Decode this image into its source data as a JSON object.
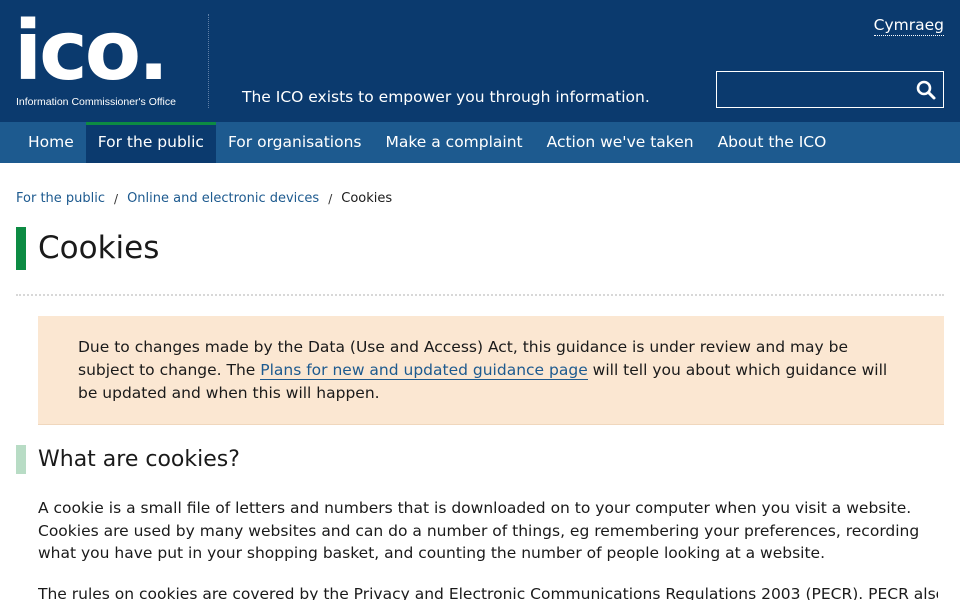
{
  "header": {
    "logo_text": "ico.",
    "logo_subtitle": "Information Commissioner's Office",
    "tagline": "The ICO exists to empower you through information.",
    "language_link": "Cymraeg",
    "search": {
      "value": "",
      "placeholder": ""
    },
    "colors": {
      "header_bg": "#0b3a6e",
      "nav_bg": "#1d5a8f",
      "active_accent": "#0d8b43"
    }
  },
  "nav": {
    "items": [
      {
        "label": "Home",
        "active": false
      },
      {
        "label": "For the public",
        "active": true
      },
      {
        "label": "For organisations",
        "active": false
      },
      {
        "label": "Make a complaint",
        "active": false
      },
      {
        "label": "Action we've taken",
        "active": false
      },
      {
        "label": "About the ICO",
        "active": false
      }
    ]
  },
  "breadcrumb": {
    "items": [
      "For the public",
      "Online and electronic devices"
    ],
    "separator": "/",
    "current": "Cookies"
  },
  "page": {
    "title": "Cookies",
    "notice": {
      "text_before": "Due to changes made by the Data (Use and Access) Act, this guidance is under review and may be subject to change. The ",
      "link_text": "Plans for new and updated guidance page",
      "text_after": " will tell you about which guidance will be updated and when this will happen.",
      "bg_color": "#fbe7d2"
    },
    "section_heading": "What are cookies?",
    "paragraph_1": "A cookie is a small file of letters and numbers that is downloaded on to your computer when you visit a website. Cookies are used by many websites and can do a number of things, eg remembering your preferences, recording what you have put in your shopping basket, and counting the number of people looking at a website.",
    "paragraph_2": "The rules on cookies are covered by the Privacy and Electronic Communications Regulations 2003 (PECR). PECR also"
  }
}
